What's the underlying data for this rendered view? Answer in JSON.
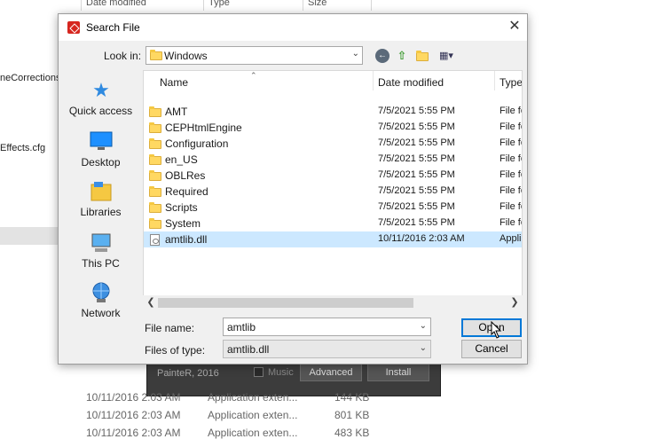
{
  "background": {
    "columns": [
      "Date modified",
      "Type",
      "Size"
    ],
    "left_items": [
      "neCorrections",
      "Effects.cfg"
    ],
    "rows": [
      {
        "date": "10/11/2016 2:03 AM",
        "type": "Application exten...",
        "size": "144 KB"
      },
      {
        "date": "10/11/2016 2:03 AM",
        "type": "Application exten...",
        "size": "801 KB"
      },
      {
        "date": "10/11/2016 2:03 AM",
        "type": "Application exten...",
        "size": "483 KB"
      }
    ]
  },
  "installer": {
    "name": "PainteR, 2016",
    "music_label": "Music",
    "advanced_label": "Advanced",
    "install_label": "Install"
  },
  "dialog": {
    "title": "Search File",
    "close_glyph": "✕",
    "look_in_label": "Look in:",
    "look_in_value": "Windows",
    "places": [
      {
        "label": "Quick access",
        "icon": "star-icon"
      },
      {
        "label": "Desktop",
        "icon": "desktop-icon"
      },
      {
        "label": "Libraries",
        "icon": "libraries-icon"
      },
      {
        "label": "This PC",
        "icon": "computer-icon"
      },
      {
        "label": "Network",
        "icon": "network-icon"
      }
    ],
    "columns": {
      "name": "Name",
      "date": "Date modified",
      "type": "Type"
    },
    "files": [
      {
        "name": "AMT",
        "date": "7/5/2021 5:55 PM",
        "type": "File fo",
        "kind": "folder"
      },
      {
        "name": "CEPHtmlEngine",
        "date": "7/5/2021 5:55 PM",
        "type": "File fo",
        "kind": "folder"
      },
      {
        "name": "Configuration",
        "date": "7/5/2021 5:55 PM",
        "type": "File fo",
        "kind": "folder"
      },
      {
        "name": "en_US",
        "date": "7/5/2021 5:55 PM",
        "type": "File fo",
        "kind": "folder"
      },
      {
        "name": "OBLRes",
        "date": "7/5/2021 5:55 PM",
        "type": "File fo",
        "kind": "folder"
      },
      {
        "name": "Required",
        "date": "7/5/2021 5:55 PM",
        "type": "File fo",
        "kind": "folder"
      },
      {
        "name": "Scripts",
        "date": "7/5/2021 5:55 PM",
        "type": "File fo",
        "kind": "folder"
      },
      {
        "name": "System",
        "date": "7/5/2021 5:55 PM",
        "type": "File fo",
        "kind": "folder"
      },
      {
        "name": "amtlib.dll",
        "date": "10/11/2016 2:03 AM",
        "type": "Appli",
        "kind": "file",
        "selected": true
      }
    ],
    "file_name_label": "File name:",
    "file_name_value": "amtlib",
    "files_of_type_label": "Files of type:",
    "files_of_type_value": "amtlib.dll",
    "open_label": "Open",
    "cancel_label": "Cancel"
  },
  "colors": {
    "accent": "#0078d7",
    "selection": "#cce8ff",
    "folder": "#ffd862"
  }
}
